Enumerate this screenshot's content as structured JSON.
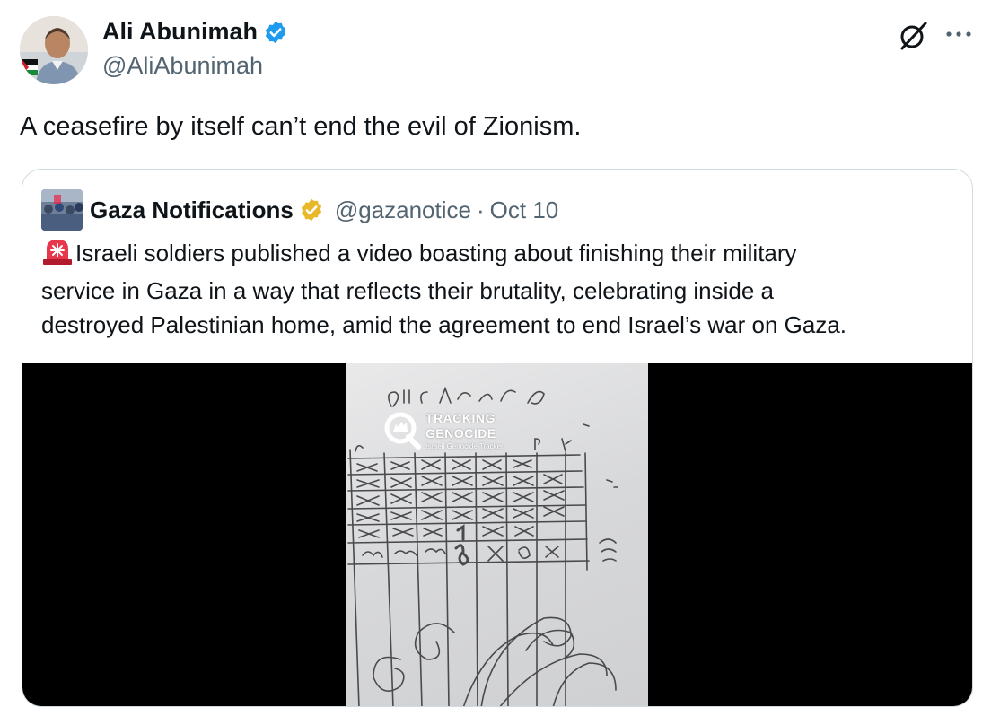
{
  "author": {
    "name": "Ali Abunimah",
    "handle": "@AliAbunimah",
    "verified_color": "#1d9bf0"
  },
  "tweet": {
    "text": "A ceasefire by itself can’t end the evil of Zionism."
  },
  "quote": {
    "name": "Gaza Notifications",
    "verified_color": "#e8b829",
    "handle": "@gazanotice",
    "separator": "·",
    "date": "Oct 10",
    "emoji": "rotating-light-siren",
    "lines": [
      "Israeli soldiers published a video boasting about finishing their military",
      "service in Gaza in a way that reflects their brutality, celebrating inside a",
      "destroyed Palestinian home, amid the agreement to end Israel’s war on Gaza."
    ],
    "media": {
      "watermark_line1": "TRACKING",
      "watermark_line2": "GENOCIDE",
      "watermark_sub": "Israeli Genocide Tracker"
    }
  },
  "icons": {
    "grok": "grok-icon",
    "more": "more-horizontal-icon"
  },
  "colors": {
    "text": "#0f1419",
    "secondary": "#536471",
    "border": "#cfd9de"
  }
}
